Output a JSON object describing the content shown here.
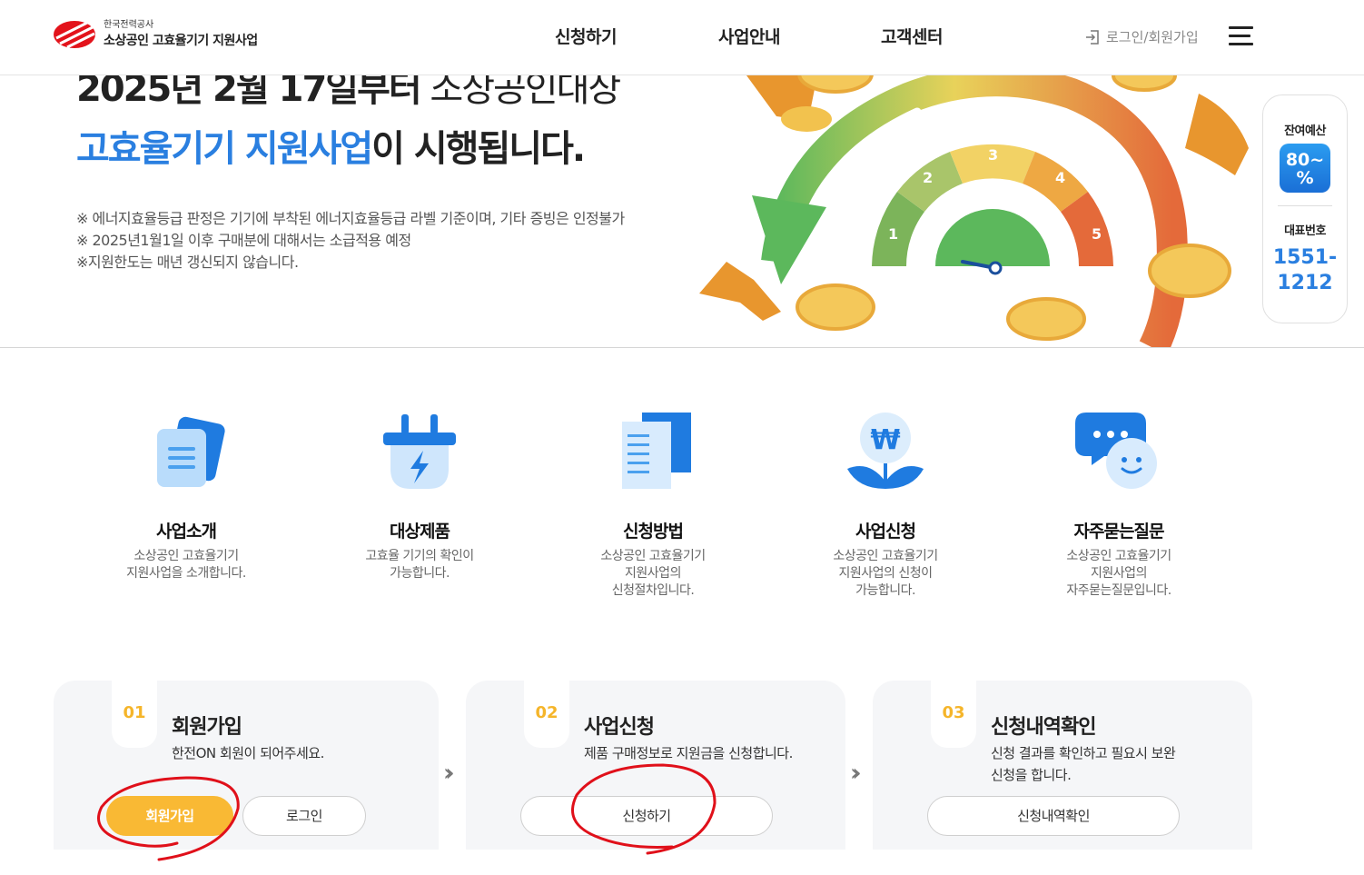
{
  "header": {
    "logo_small": "한국전력공사",
    "logo_main": "소상공인 고효율기기 지원사업",
    "nav": [
      "신청하기",
      "사업안내",
      "고객센터"
    ],
    "login_label": "로그인/회원가입"
  },
  "hero": {
    "line1_bold": "2025년 2월 17일부터",
    "line1_light": " 소상공인대상",
    "line2_accent": "고효율기기 지원사업",
    "line2_rest": "이 시행됩니다.",
    "notes": [
      "※ 에너지효율등급 판정은 기기에 부착된 에너지효율등급 라벨 기준이며, 기타 증빙은 인정불가",
      "※ 2025년1월1일 이후 구매분에 대해서는 소급적용 예정",
      "※지원한도는 매년 갱신되지 않습니다."
    ],
    "gauge_numbers": [
      "1",
      "2",
      "3",
      "4",
      "5"
    ]
  },
  "side_widget": {
    "budget_label": "잔여예산",
    "budget_value_line1": "80~",
    "budget_value_line2": "%",
    "phone_label": "대표번호",
    "phone_line1": "1551-",
    "phone_line2": "1212"
  },
  "quick_menu": [
    {
      "title": "사업소개",
      "desc": "소상공인 고효율기기\n지원사업을 소개합니다.",
      "icon": "document-icon"
    },
    {
      "title": "대상제품",
      "desc": "고효율 기기의 확인이\n가능합니다.",
      "icon": "plug-icon"
    },
    {
      "title": "신청방법",
      "desc": "소상공인 고효율기기\n지원사업의\n신청절차입니다.",
      "icon": "guide-document-icon"
    },
    {
      "title": "사업신청",
      "desc": "소상공인 고효율기기\n지원사업의 신청이\n가능합니다.",
      "icon": "won-sprout-icon"
    },
    {
      "title": "자주묻는질문",
      "desc": "소상공인 고효율기기\n지원사업의\n자주묻는질문입니다.",
      "icon": "chat-bubble-icon"
    }
  ],
  "steps": [
    {
      "num": "01",
      "title": "회원가입",
      "desc": "한전ON 회원이 되어주세요.",
      "buttons": [
        "회원가입",
        "로그인"
      ]
    },
    {
      "num": "02",
      "title": "사업신청",
      "desc": "제품 구매정보로 지원금을 신청합니다.",
      "buttons": [
        "신청하기"
      ]
    },
    {
      "num": "03",
      "title": "신청내역확인",
      "desc": "신청 결과를 확인하고 필요시 보완\n신청을 합니다.",
      "buttons": [
        "신청내역확인"
      ]
    }
  ],
  "colors": {
    "accent_blue": "#2a7fe0",
    "accent_yellow": "#f9b934",
    "annotation_red": "#e0101a"
  }
}
